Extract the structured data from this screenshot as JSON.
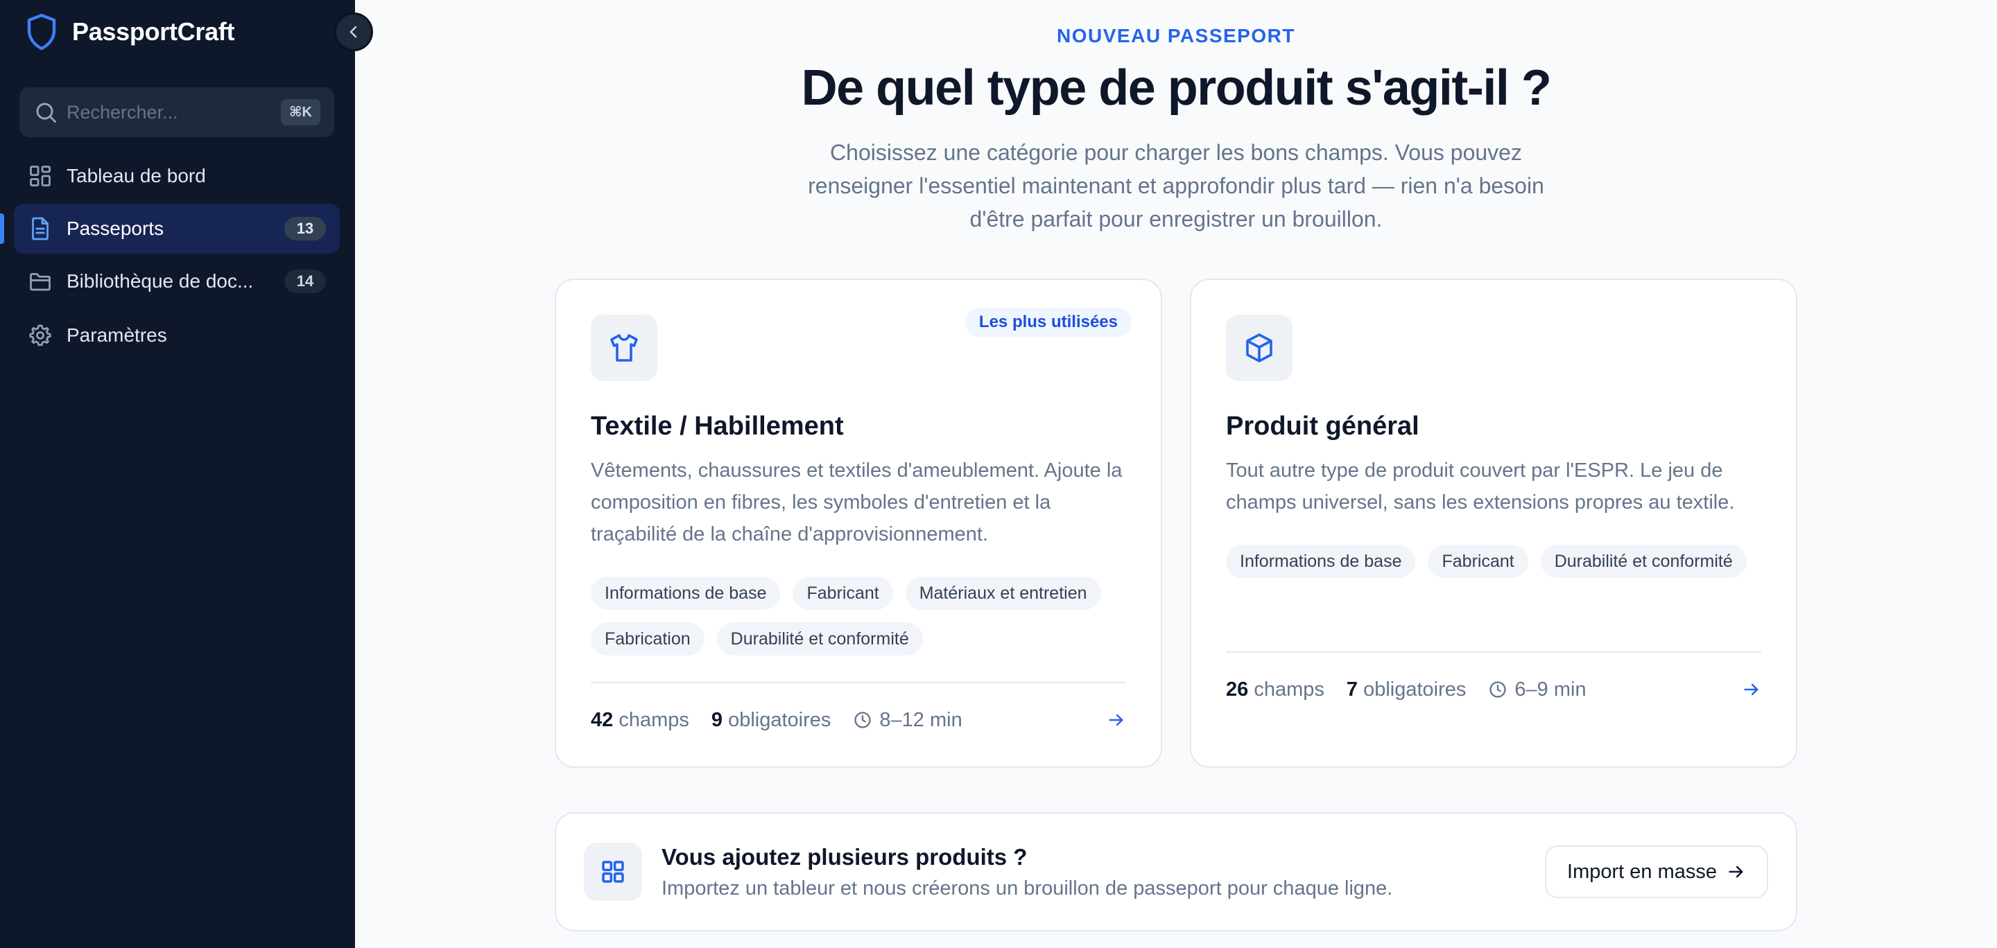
{
  "app": {
    "name": "PassportCraft"
  },
  "search": {
    "placeholder": "Rechercher...",
    "shortcut": "⌘K"
  },
  "sidebar": {
    "items": [
      {
        "label": "Tableau de bord",
        "icon": "dashboard-icon",
        "active": false
      },
      {
        "label": "Passeports",
        "icon": "document-icon",
        "count": "13",
        "active": true
      },
      {
        "label": "Bibliothèque de doc...",
        "icon": "folder-icon",
        "count": "14",
        "active": false
      },
      {
        "label": "Paramètres",
        "icon": "gear-icon",
        "active": false
      }
    ]
  },
  "main": {
    "eyebrow": "NOUVEAU PASSEPORT",
    "title": "De quel type de produit s'agit-il ?",
    "subtitle": "Choisissez une catégorie pour charger les bons champs. Vous pouvez renseigner l'essentiel maintenant et approfondir plus tard — rien n'a besoin d'être parfait pour enregistrer un brouillon."
  },
  "cards": [
    {
      "icon": "shirt-icon",
      "badge": "Les plus utilisées",
      "title": "Textile / Habillement",
      "description": "Vêtements, chaussures et textiles d'ameublement. Ajoute la composition en fibres, les symboles d'entretien et la traçabilité de la chaîne d'approvisionnement.",
      "tags": [
        "Informations de base",
        "Fabricant",
        "Matériaux et entretien",
        "Fabrication",
        "Durabilité et conformité"
      ],
      "fields_count": "42",
      "fields_label": "champs",
      "required_count": "9",
      "required_label": "obligatoires",
      "time": "8–12 min"
    },
    {
      "icon": "box-icon",
      "title": "Produit général",
      "description": "Tout autre type de produit couvert par l'ESPR. Le jeu de champs universel, sans les extensions propres au textile.",
      "tags": [
        "Informations de base",
        "Fabricant",
        "Durabilité et conformité"
      ],
      "fields_count": "26",
      "fields_label": "champs",
      "required_count": "7",
      "required_label": "obligatoires",
      "time": "6–9 min"
    }
  ],
  "bulk": {
    "icon": "grid-icon",
    "title": "Vous ajoutez plusieurs produits ?",
    "description": "Importez un tableur et nous créerons un brouillon de passeport pour chaque ligne.",
    "button_label": "Import en masse"
  },
  "colors": {
    "sidebar_bg": "#0f172a",
    "accent": "#2563eb",
    "page_bg": "#f8fafc"
  }
}
